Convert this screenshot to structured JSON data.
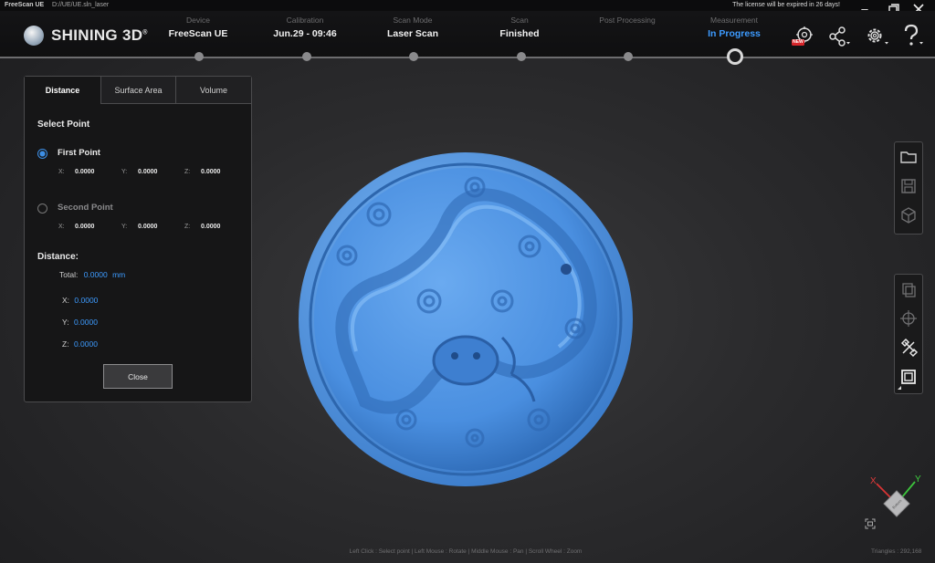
{
  "titlebar": {
    "app_name": "FreeScan UE",
    "file_path": "D://UE/UE.sln_laser",
    "license_notice": "The license will be expired in 26 days!"
  },
  "brand": {
    "name": "SHINING 3D",
    "mark": "®"
  },
  "steps": [
    {
      "label": "Device",
      "value": "FreeScan UE"
    },
    {
      "label": "Calibration",
      "value": "Jun.29 - 09:46"
    },
    {
      "label": "Scan Mode",
      "value": "Laser Scan"
    },
    {
      "label": "Scan",
      "value": "Finished"
    },
    {
      "label": "Post Processing",
      "value": ""
    },
    {
      "label": "Measurement",
      "value": "In Progress"
    }
  ],
  "header_icons": {
    "new_badge": "NEW",
    "items": [
      "model-new-icon",
      "share-icon",
      "gear-icon",
      "help-icon"
    ]
  },
  "panel": {
    "tabs": [
      "Distance",
      "Surface Area",
      "Volume"
    ],
    "selected_tab": "Distance",
    "select_point_title": "Select Point",
    "first_point": {
      "label": "First Point",
      "x_label": "X:",
      "x": "0.0000",
      "y_label": "Y:",
      "y": "0.0000",
      "z_label": "Z:",
      "z": "0.0000"
    },
    "second_point": {
      "label": "Second Point",
      "x_label": "X:",
      "x": "0.0000",
      "y_label": "Y:",
      "y": "0.0000",
      "z_label": "Z:",
      "z": "0.0000"
    },
    "distance_title": "Distance:",
    "total_label": "Total:",
    "total_value": "0.0000",
    "total_unit": "mm",
    "dx_label": "X:",
    "dx": "0.0000",
    "dy_label": "Y:",
    "dy": "0.0000",
    "dz_label": "Z:",
    "dz": "0.0000",
    "close_label": "Close"
  },
  "axis_gizmo": {
    "x_label": "X",
    "y_label": "Y",
    "face_label": "Bottom"
  },
  "status": {
    "hint": "Left Click : Select point | Left Mouse : Rotate | Middle Mouse : Pan | Scroll Wheel : Zoom",
    "triangles": "Triangles : 292,168"
  },
  "colors": {
    "accent": "#3d9bff",
    "model": "#4a8fe0",
    "header_bg": "#111112"
  }
}
